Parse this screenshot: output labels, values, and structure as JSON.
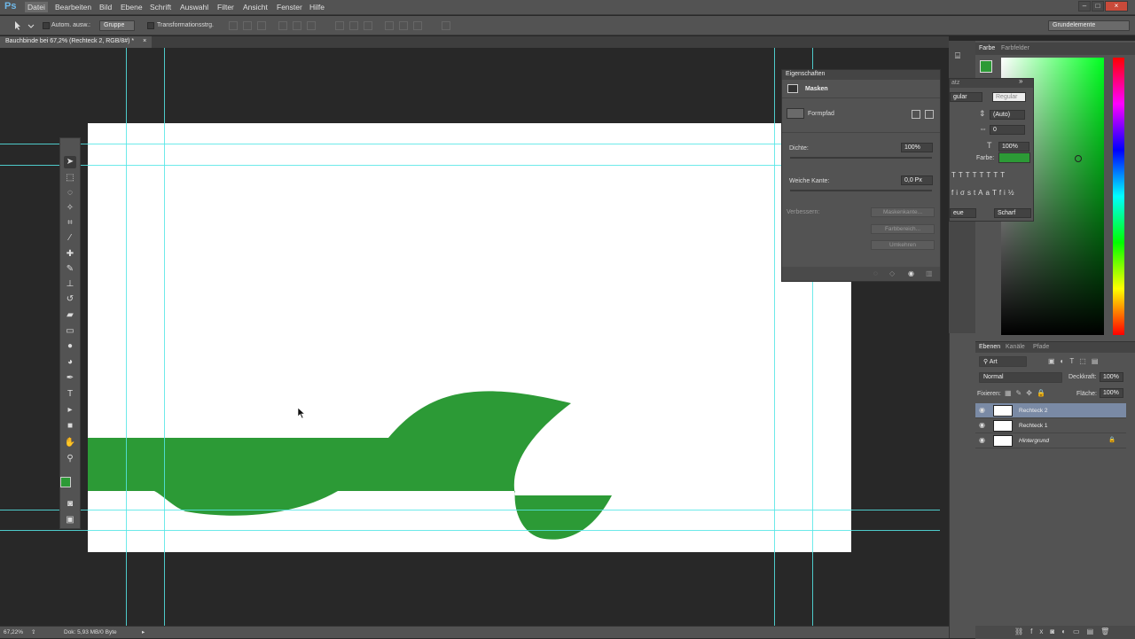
{
  "app": {
    "logo": "Ps"
  },
  "menu": [
    "Datei",
    "Bearbeiten",
    "Bild",
    "Ebene",
    "Schrift",
    "Auswahl",
    "Filter",
    "Ansicht",
    "Fenster",
    "Hilfe"
  ],
  "options": {
    "auto_select_label": "Autom. ausw.:",
    "auto_select_value": "Gruppe",
    "transform_label": "Transformationsstrg.",
    "workspace": "Grundelemente"
  },
  "document": {
    "tab_title": "Bauchbinde bei 67,2% (Rechteck 2, RGB/8#) *",
    "tab_close": "×"
  },
  "properties": {
    "title": "Eigenschaften",
    "section": "Masken",
    "path_label": "Formpfad",
    "density_label": "Dichte:",
    "density_value": "100%",
    "feather_label": "Weiche Kante:",
    "feather_value": "0,0 Px",
    "refine_label": "Verbessern:",
    "btn_mask_edge": "Maskenkante...",
    "btn_color_range": "Farbbereich...",
    "btn_invert": "Umkehren"
  },
  "character": {
    "tab": "atz",
    "style_partial": "gular",
    "style": "Regular",
    "leading": "(Auto)",
    "tracking": "0",
    "scale": "100%",
    "color_label": "Farbe:",
    "lang_partial": "eue",
    "antialias": "Scharf"
  },
  "color_panel": {
    "tab_color": "Farbe",
    "tab_swatches": "Farbfelder",
    "fg_color": "#2c9a36"
  },
  "layers": {
    "tabs": [
      "Ebenen",
      "Kanäle",
      "Pfade"
    ],
    "filter": "Art",
    "blend_mode": "Normal",
    "opacity_label": "Deckkraft:",
    "opacity_value": "100%",
    "lock_label": "Fixieren:",
    "fill_label": "Fläche:",
    "fill_value": "100%",
    "items": [
      {
        "name": "Rechteck 2",
        "selected": true
      },
      {
        "name": "Rechteck 1",
        "selected": false
      },
      {
        "name": "Hintergrund",
        "selected": false
      }
    ]
  },
  "status": {
    "zoom": "67,22%",
    "doc_info": "Dok: 5,93 MB/0 Byte"
  },
  "colors": {
    "shape_green": "#2c9a36",
    "guide": "#55e6e6"
  }
}
